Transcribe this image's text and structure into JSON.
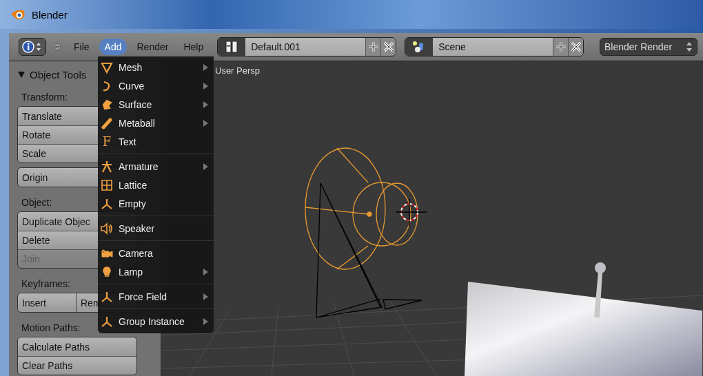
{
  "window": {
    "title": "Blender"
  },
  "header": {
    "menus": [
      {
        "label": "File",
        "selected": false
      },
      {
        "label": "Add",
        "selected": true
      },
      {
        "label": "Render",
        "selected": false
      },
      {
        "label": "Help",
        "selected": false
      }
    ],
    "layout_field": "Default.001",
    "scene_field": "Scene",
    "render_engine": "Blender Render"
  },
  "tool_panel": {
    "title": "Object Tools",
    "expanded": true,
    "sections": [
      {
        "label": "Transform:",
        "groups": [
          [
            {
              "label": "Translate",
              "disabled": false
            },
            {
              "label": "Rotate",
              "disabled": false
            },
            {
              "label": "Scale",
              "disabled": false
            }
          ],
          [
            {
              "label": "Origin",
              "disabled": false
            }
          ]
        ]
      },
      {
        "label": "Object:",
        "groups": [
          [
            {
              "label": "Duplicate Objec",
              "disabled": false
            },
            {
              "label": "Delete",
              "disabled": false
            },
            {
              "label": "Join",
              "disabled": true
            }
          ]
        ]
      },
      {
        "label": "Keyframes:",
        "row": true,
        "groups": [
          [
            {
              "label": "Insert",
              "disabled": false
            },
            {
              "label": "Rem",
              "disabled": false
            }
          ]
        ]
      },
      {
        "label": "Motion Paths:",
        "groups": [
          [
            {
              "label": "Calculate Paths",
              "disabled": false
            },
            {
              "label": "Clear Paths",
              "disabled": false
            }
          ]
        ]
      }
    ]
  },
  "viewport": {
    "label": "User Persp"
  },
  "add_menu": {
    "groups": [
      [
        {
          "label": "Mesh",
          "kind": "mesh",
          "submenu": true
        },
        {
          "label": "Curve",
          "kind": "curve",
          "submenu": true
        },
        {
          "label": "Surface",
          "kind": "surface",
          "submenu": true
        },
        {
          "label": "Metaball",
          "kind": "metaball",
          "submenu": true
        },
        {
          "label": "Text",
          "kind": "glyph",
          "glyph": "F",
          "submenu": false
        }
      ],
      [
        {
          "label": "Armature",
          "kind": "armature",
          "submenu": true
        },
        {
          "label": "Lattice",
          "kind": "lattice",
          "submenu": false
        },
        {
          "label": "Empty",
          "kind": "empty",
          "submenu": false
        }
      ],
      [
        {
          "label": "Speaker",
          "kind": "speaker",
          "submenu": false
        }
      ],
      [
        {
          "label": "Camera",
          "kind": "camera",
          "submenu": false
        },
        {
          "label": "Lamp",
          "kind": "lamp",
          "submenu": true
        }
      ],
      [
        {
          "label": "Force Field",
          "kind": "empty",
          "submenu": true
        }
      ],
      [
        {
          "label": "Group Instance",
          "kind": "empty",
          "submenu": true
        }
      ]
    ]
  }
}
